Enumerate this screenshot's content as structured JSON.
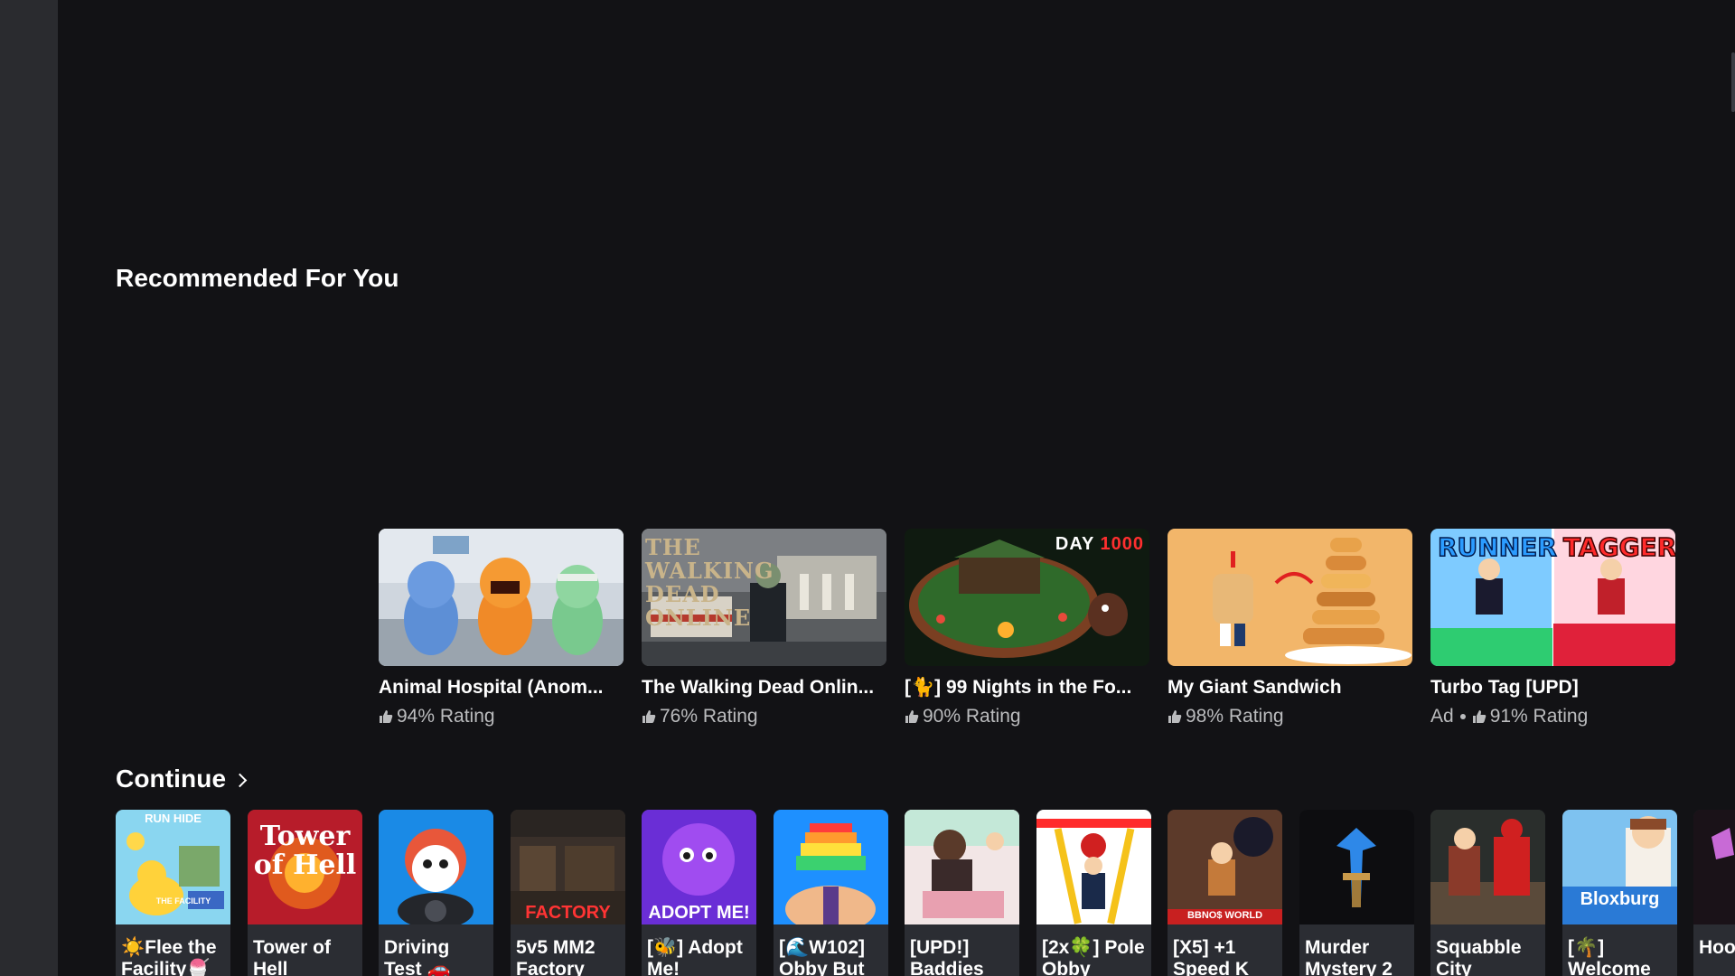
{
  "sections": {
    "recommended_title": "Recommended For You",
    "continue_title": "Continue"
  },
  "recommended": [
    {
      "title": "Animal Hospital (Anom...",
      "ad": "",
      "rating": "94% Rating"
    },
    {
      "title": "The Walking Dead Onlin...",
      "ad": "",
      "rating": "76% Rating",
      "thumb_text": "THE WALKING DEAD ONLINE"
    },
    {
      "title": "[🐈] 99 Nights in the Fo...",
      "ad": "",
      "rating": "90% Rating",
      "badge_day": "DAY",
      "badge_num": "1000"
    },
    {
      "title": "My Giant Sandwich",
      "ad": "",
      "rating": "98% Rating"
    },
    {
      "title": "Turbo Tag [UPD]",
      "ad": "Ad",
      "rating": "91% Rating",
      "thumb_left": "RUNNER",
      "thumb_right": "TAGGER"
    }
  ],
  "continue": [
    {
      "title": "☀️Flee the Facility🍧",
      "thumb_text": "RUN  HIDE",
      "thumb_sub": "THE FACILITY"
    },
    {
      "title": "Tower of Hell",
      "thumb_text": "Tower of Hell"
    },
    {
      "title": "Driving Test 🚗",
      "thumb_text": ""
    },
    {
      "title": "5v5 MM2 Factory",
      "thumb_text": "FACTORY"
    },
    {
      "title": "[🐝] Adopt Me!",
      "thumb_text": "ADOPT ME!"
    },
    {
      "title": "[🌊W102] Obby But",
      "thumb_text": ""
    },
    {
      "title": "[UPD!] Baddies",
      "thumb_text": ""
    },
    {
      "title": "[2x🍀] Pole Obby",
      "thumb_text": ""
    },
    {
      "title": "[X5] +1 Speed K",
      "thumb_text": "BBNO$ WORLD"
    },
    {
      "title": "Murder Mystery 2",
      "thumb_text": ""
    },
    {
      "title": "Squabble City",
      "thumb_text": ""
    },
    {
      "title": "[🌴] Welcome",
      "thumb_text": "Bloxburg"
    },
    {
      "title": "Hoo Cus",
      "thumb_text": ""
    }
  ],
  "colors": {
    "background": "#121215",
    "rail": "#2a2b2f",
    "card": "#2b2d33",
    "muted_text": "#bbbcbe"
  },
  "icons": {
    "rating": "thumbs-up-icon",
    "continue_arrow": "chevron-right-icon"
  }
}
